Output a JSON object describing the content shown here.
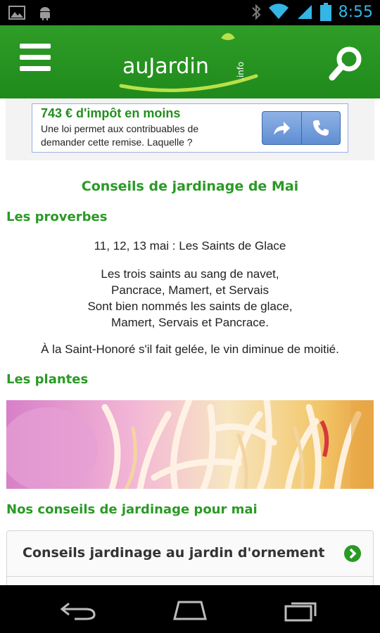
{
  "status_bar": {
    "time": "8:55",
    "icons": [
      "image-notification-icon",
      "android-notification-icon",
      "bluetooth-icon",
      "wifi-icon",
      "signal-icon",
      "battery-icon"
    ]
  },
  "app_bar": {
    "logo_text": "auJardin",
    "logo_suffix": ".info",
    "menu_icon": "menu-icon",
    "search_icon": "search-icon"
  },
  "ad": {
    "title": "743 € d'impôt en moins",
    "text": "Une loi permet aux contribuables de demander cette remise. Laquelle ?",
    "buttons": [
      "share-arrow-icon",
      "phone-icon"
    ]
  },
  "article": {
    "title": "Conseils de jardinage de Mai",
    "section_proverbes": "Les proverbes",
    "proverb_1": "11, 12, 13 mai : Les Saints de Glace",
    "proverb_2_lines": [
      "Les trois saints au sang de navet,",
      "Pancrace, Mamert, et Servais",
      "Sont bien nommés les saints de glace,",
      "Mamert, Servais et Pancrace."
    ],
    "proverb_3": "À la Saint-Honoré s'il fait gelée, le vin diminue de moitié.",
    "section_plantes": "Les plantes",
    "section_conseils": "Nos conseils de jardinage pour mai",
    "card_label": "Conseils jardinage au jardin d'ornement"
  },
  "colors": {
    "brand_green": "#2a9a25",
    "statusbar_accent": "#33b5e5"
  }
}
